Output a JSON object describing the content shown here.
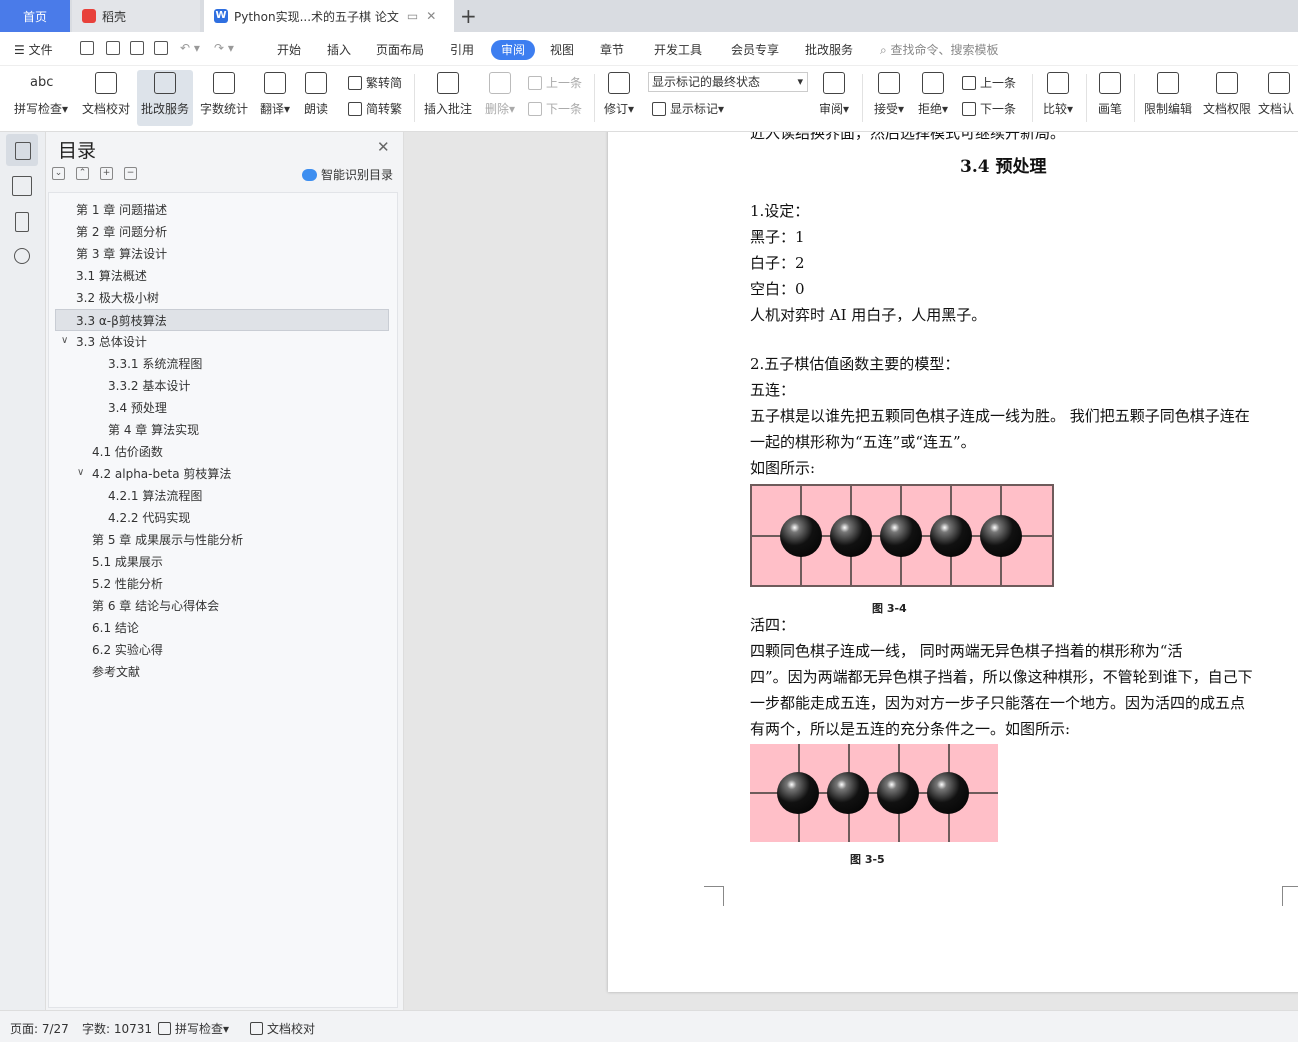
{
  "tabs": {
    "home": "首页",
    "daoke": "稻壳",
    "doc": "Python实现...术的五子棋 论文",
    "doc_icon": "W",
    "add": "+"
  },
  "menu": {
    "file": "文件",
    "items": [
      "开始",
      "插入",
      "页面布局",
      "引用",
      "审阅",
      "视图",
      "章节",
      "开发工具",
      "会员专享",
      "批改服务"
    ],
    "active": "审阅",
    "search": "查找命令、搜索模板"
  },
  "ribbon": {
    "spell": "拼写检查",
    "spell_icon_text": "abc",
    "proofread": "文档校对",
    "grading": "批改服务",
    "wordcount": "字数统计",
    "translate": "翻译",
    "read": "朗读",
    "to_trad": "繁转简",
    "to_simp": "简转繁",
    "insert_comment": "插入批注",
    "delete": "删除",
    "prev": "上一条",
    "next": "下一条",
    "revise": "修订",
    "markup_state": "显示标记的最终状态",
    "show_markup": "显示标记",
    "review": "审阅",
    "accept": "接受",
    "reject": "拒绝",
    "prev2": "上一条",
    "next2": "下一条",
    "compare": "比较",
    "pen": "画笔",
    "restrict": "限制编辑",
    "permission": "文档权限",
    "cert": "文档认"
  },
  "toc": {
    "title": "目录",
    "smart": "智能识别目录",
    "items": [
      "第 1 章  问题描述",
      "第 2 章  问题分析",
      "第 3 章  算法设计",
      "3.1  算法概述",
      "3.2  极大极小树",
      "3.3 α-β剪枝算法",
      "3.3 总体设计",
      "3.3.1  系统流程图",
      "3.3.2  基本设计",
      "3.4  预处理",
      "第 4 章  算法实现",
      "4.1  估价函数",
      "4.2 alpha-beta 剪枝算法",
      "4.2.1  算法流程图",
      "4.2.2  代码实现",
      "第 5 章  成果展示与性能分析",
      "5.1  成果展示",
      "5.2  性能分析",
      "第 6 章  结论与心得体会",
      "6.1  结论",
      "6.2  实验心得",
      "参考文献"
    ]
  },
  "doc": {
    "top_cut": "近入读结换界面，然后选择模式可继续开新局。",
    "heading": "3.4  预处理",
    "lines": [
      "1.设定：",
      "黑子：1",
      "白子：2",
      "空白：0",
      "人机对弈时 AI 用白子，人用黑子。",
      "2.五子棋估值函数主要的模型：",
      "五连：",
      "五子棋是以谁先把五颗同色棋子连成一线为胜。 我们把五颗子同色棋子连在",
      "一起的棋形称为“五连”或“连五”。",
      "如图所示:",
      "活四：",
      "四颗同色棋子连成一线，   同时两端无异色棋子挡着的棋形称为“活",
      "四”。因为两端都无异色棋子挡着，所以像这种棋形，不管轮到谁下，自己下",
      "一步都能走成五连，因为对方一步子只能落在一个地方。因为活四的成五点",
      "有两个，所以是五连的充分条件之一。如图所示:"
    ],
    "caption1": "图  3-4",
    "caption2": "图  3-5",
    "board1_stones": 5,
    "board2_stones": 4
  },
  "status": {
    "page": "页面: 7/27",
    "words": "字数: 10731",
    "spell": "拼写检查",
    "proofread": "文档校对"
  }
}
